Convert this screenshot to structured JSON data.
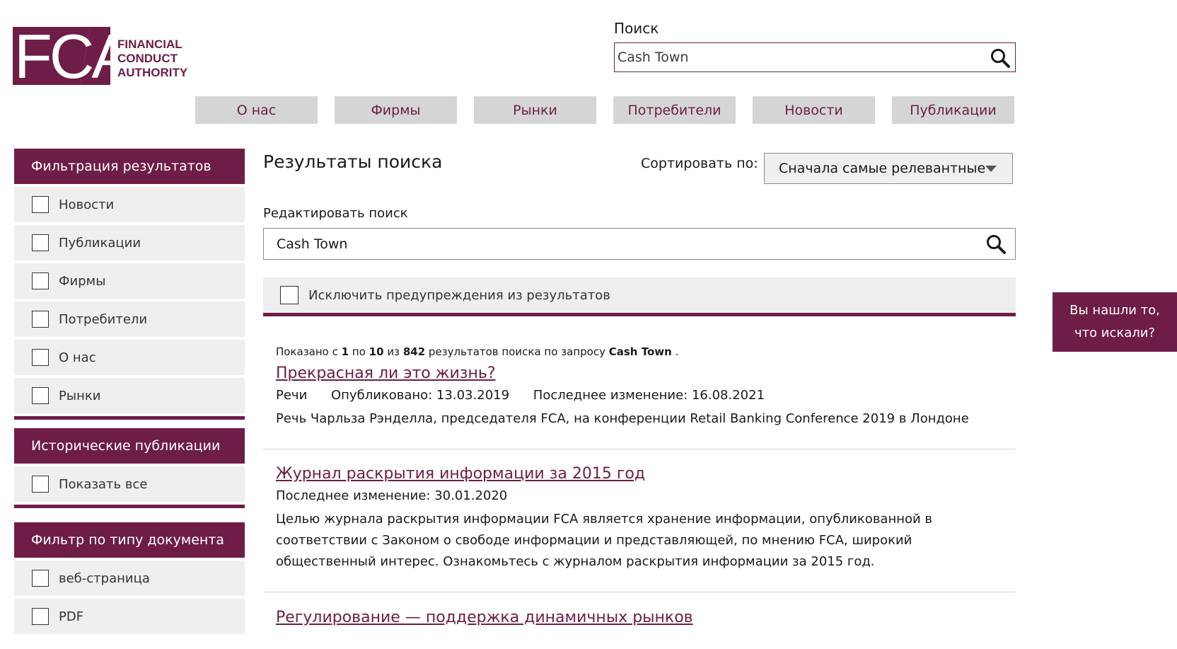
{
  "logo": {
    "mark": "FCA",
    "line1": "FINANCIAL",
    "line2": "CONDUCT",
    "line3": "AUTHORITY"
  },
  "header": {
    "search_label": "Поиск",
    "search_value": "Cash Town",
    "nav": [
      "О нас",
      "Фирмы",
      "Рынки",
      "Потребители",
      "Новости",
      "Публикации"
    ]
  },
  "sidebar": {
    "filter": {
      "title": "Фильтрация результатов",
      "items": [
        "Новости",
        "Публикации",
        "Фирмы",
        "Потребители",
        "О нас",
        "Рынки"
      ]
    },
    "historical": {
      "title": "Исторические публикации",
      "items": [
        "Показать все"
      ]
    },
    "doctype": {
      "title": "Фильтр по типу документа",
      "items": [
        "веб-страница",
        "PDF"
      ]
    }
  },
  "main": {
    "title": "Результаты поиска",
    "sort_label": "Сортировать по:",
    "sort_value": "Сначала самые релевантные",
    "edit_label": "Редактировать поиск",
    "edit_value": "Cash Town",
    "exclude_label": "Исключить предупреждения из результатов",
    "shown": {
      "prefix": "Показано с",
      "from": "1",
      "to_word": "по",
      "to": "10",
      "of_word": "из",
      "total": "842",
      "suffix": "результатов поиска по запросу",
      "query": "Cash Town",
      "end": "."
    },
    "results": [
      {
        "title": "Прекрасная ли это жизнь?",
        "type": "Речи",
        "published": "Опубликовано: 13.03.2019",
        "modified": "Последнее изменение: 16.08.2021",
        "description": "Речь Чарльза Рэнделла, председателя FCA, на конференции Retail Banking Conference 2019 в Лондоне"
      },
      {
        "title": "Журнал раскрытия информации за 2015 год",
        "modified": "Последнее изменение: 30.01.2020",
        "description_lines": [
          "Целью журнала раскрытия информации FCA является хранение информации, опубликованной в",
          "соответствии с Законом о свободе информации и представляющей, по мнению FCA, широкий",
          "общественный интерес. Ознакомьтесь с журналом раскрытия информации за 2015 год."
        ]
      },
      {
        "title": "Регулирование — поддержка динамичных рынков"
      }
    ]
  },
  "feedback": {
    "line1": "Вы нашли то,",
    "line2": "что искали?"
  },
  "colors": {
    "brand": "#6e1d46",
    "nav_bg": "#d5d5d7",
    "panel_bg": "#efeff0"
  },
  "icons": {
    "search": "search-icon",
    "sort_caret": "caret-down-icon",
    "checkbox": "checkbox-icon"
  }
}
